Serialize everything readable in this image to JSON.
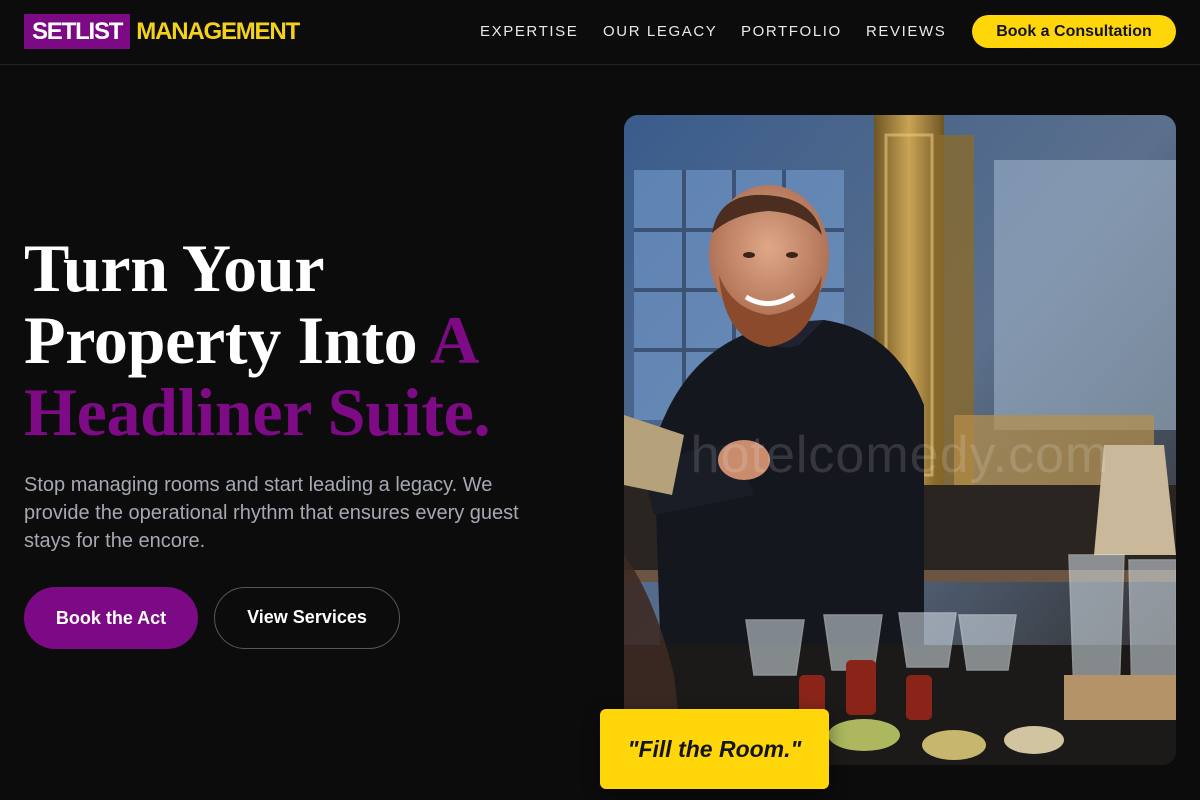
{
  "brand": {
    "box_text": "SETLIST",
    "rest_text": "MANAGEMENT",
    "colors": {
      "purple": "#7b0a84",
      "yellow": "#ffd60a",
      "background": "#0c0c0d"
    }
  },
  "nav": {
    "links": [
      "EXPERTISE",
      "OUR LEGACY",
      "PORTFOLIO",
      "REVIEWS"
    ],
    "cta_label": "Book a Consultation"
  },
  "hero": {
    "headline_line1": "Turn Your",
    "headline_line2": "Property Into",
    "headline_accent_inline": "A",
    "headline_line3": "Headliner Suite.",
    "subcopy": "Stop managing rooms and start leading a legacy. We provide the operational rhythm that ensures every guest stays for the encore.",
    "primary_button": "Book the Act",
    "secondary_button": "View Services"
  },
  "photo": {
    "subject": "smiling bartender mixing drinks at a bar",
    "watermark": "hotelcomedy.com"
  },
  "quote_card": {
    "text": "\"Fill the Room.\""
  }
}
